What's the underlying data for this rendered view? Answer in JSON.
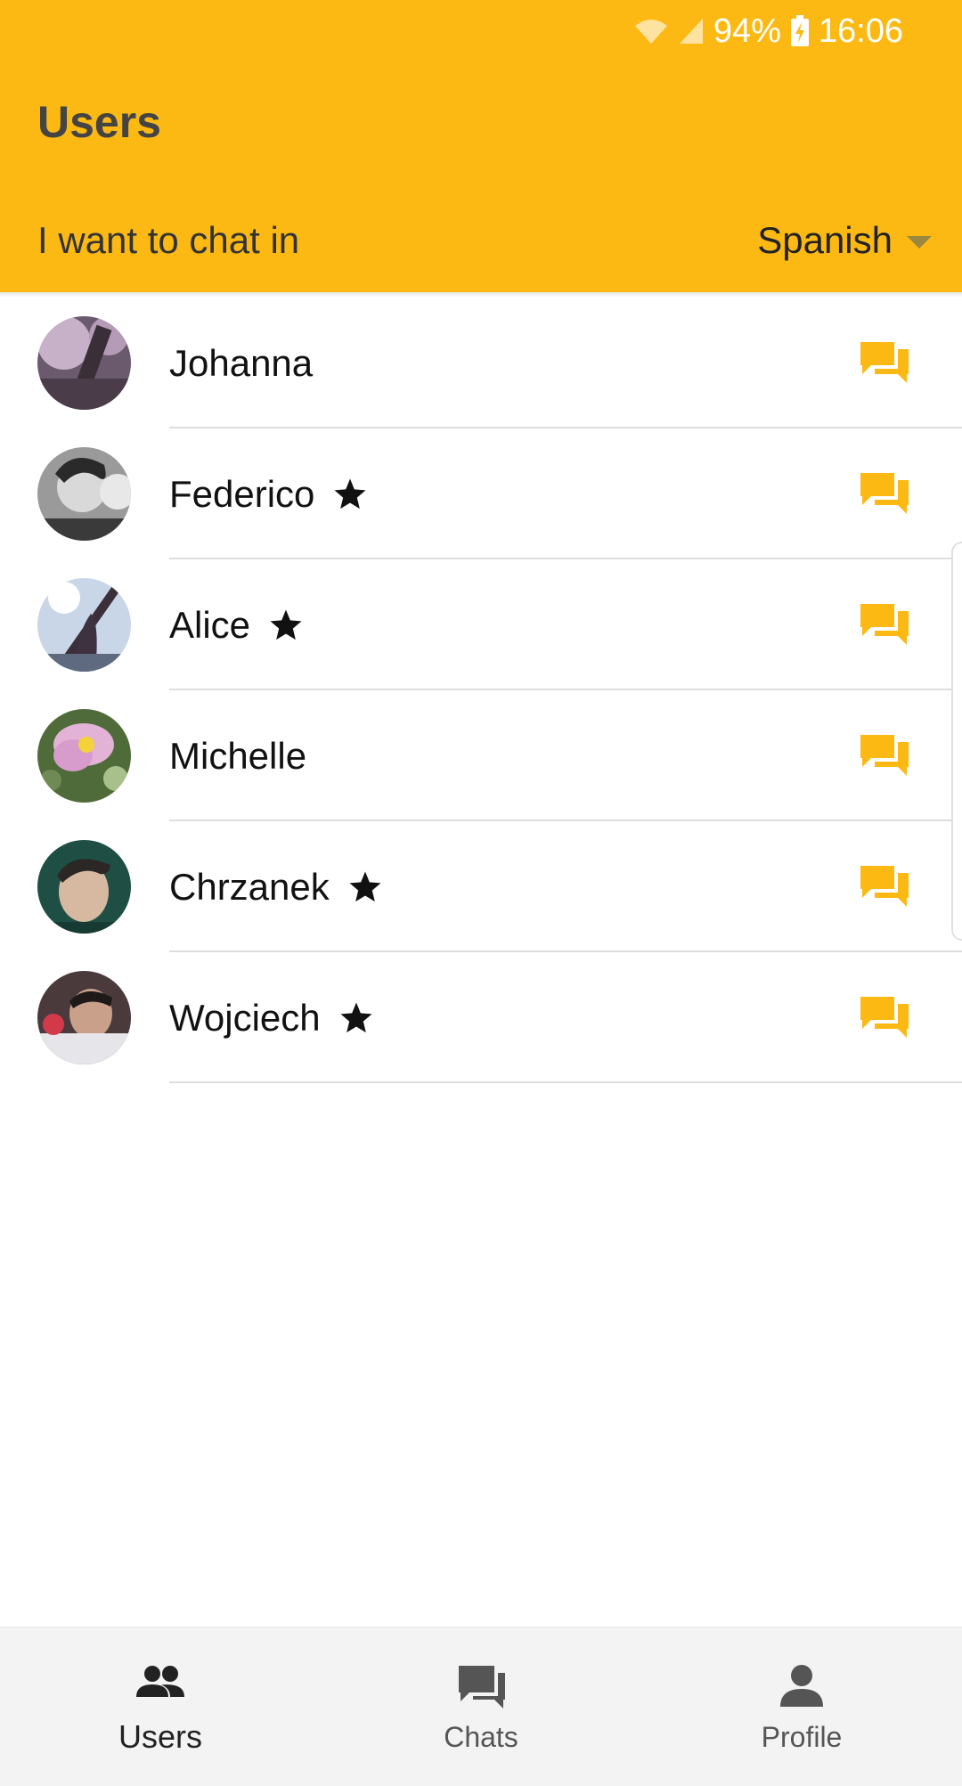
{
  "status_bar": {
    "battery": "94%",
    "time": "16:06"
  },
  "header": {
    "title": "Users",
    "language_label": "I want to chat in",
    "language_value": "Spanish"
  },
  "colors": {
    "accent": "#FDB913",
    "title": "#444444"
  },
  "users": [
    {
      "name": "Johanna",
      "starred": false,
      "avatar_icon": "photo-avatar"
    },
    {
      "name": "Federico",
      "starred": true,
      "avatar_icon": "photo-avatar"
    },
    {
      "name": "Alice",
      "starred": true,
      "avatar_icon": "photo-avatar"
    },
    {
      "name": "Michelle",
      "starred": false,
      "avatar_icon": "photo-avatar"
    },
    {
      "name": "Chrzanek",
      "starred": true,
      "avatar_icon": "photo-avatar"
    },
    {
      "name": "Wojciech",
      "starred": true,
      "avatar_icon": "photo-avatar"
    }
  ],
  "bottom_nav": {
    "items": [
      {
        "label": "Users",
        "icon": "people-icon",
        "active": true
      },
      {
        "label": "Chats",
        "icon": "chat-icon",
        "active": false
      },
      {
        "label": "Profile",
        "icon": "person-icon",
        "active": false
      }
    ]
  }
}
